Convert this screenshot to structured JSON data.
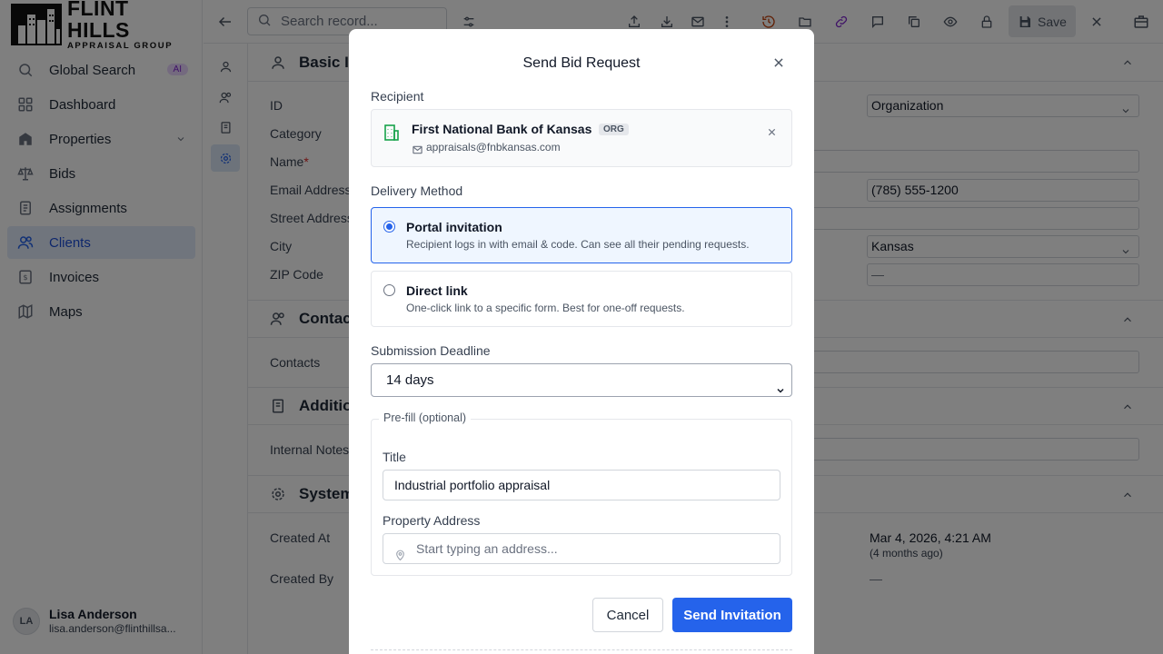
{
  "app": {
    "logo_title": "FLINT HILLS",
    "logo_subtitle": "APPRAISAL GROUP"
  },
  "sidebar": {
    "items": [
      {
        "label": "Global Search",
        "icon": "search-icon",
        "badge": "AI"
      },
      {
        "label": "Dashboard",
        "icon": "dashboard-icon"
      },
      {
        "label": "Properties",
        "icon": "building-icon"
      },
      {
        "label": "Bids",
        "icon": "scale-icon"
      },
      {
        "label": "Assignments",
        "icon": "clipboard-icon"
      },
      {
        "label": "Clients",
        "icon": "users-icon",
        "active": true
      },
      {
        "label": "Invoices",
        "icon": "invoice-icon"
      },
      {
        "label": "Maps",
        "icon": "map-icon"
      }
    ],
    "user": {
      "initials": "LA",
      "name": "Lisa Anderson",
      "email": "lisa.anderson@flinthillsa..."
    }
  },
  "toolbar": {
    "search_placeholder": "Search record...",
    "save_label": "Save"
  },
  "record": {
    "sections": {
      "basic": "Basic In",
      "contacts": "Contac",
      "additional": "Additio",
      "system": "System"
    },
    "fields": {
      "id": "ID",
      "category": "Category",
      "name": "Name",
      "name_required": "*",
      "email": "Email Address",
      "street": "Street Address",
      "city": "City",
      "zip": "ZIP Code",
      "contacts": "Contacts",
      "internal_notes": "Internal Notes",
      "created_at": "Created At",
      "created_by": "Created By"
    },
    "values": {
      "category": "Organization",
      "phone": "(785) 555-1200",
      "state": "Kansas",
      "zip_placeholder": "—",
      "created_at": "Mar 4, 2026, 4:21 AM",
      "created_at_relative": "(4 months ago)",
      "created_by": "—"
    }
  },
  "modal": {
    "title": "Send Bid Request",
    "recipient_label": "Recipient",
    "recipient": {
      "name": "First National Bank of Kansas",
      "badge": "ORG",
      "email": "appraisals@fnbkansas.com"
    },
    "delivery_label": "Delivery Method",
    "options": [
      {
        "title": "Portal invitation",
        "desc": "Recipient logs in with email & code. Can see all their pending requests.",
        "selected": true
      },
      {
        "title": "Direct link",
        "desc": "One-click link to a specific form. Best for one-off requests.",
        "selected": false
      }
    ],
    "deadline_label": "Submission Deadline",
    "deadline_value": "14 days",
    "prefill_legend": "Pre-fill (optional)",
    "title_label": "Title",
    "title_value": "Industrial portfolio appraisal",
    "address_label": "Property Address",
    "address_placeholder": "Start typing an address...",
    "cancel_label": "Cancel",
    "send_label": "Send Invitation"
  },
  "colors": {
    "accent": "#2563eb",
    "active_bg": "#e0ebfb",
    "ai_badge": "#e9d5ff"
  }
}
